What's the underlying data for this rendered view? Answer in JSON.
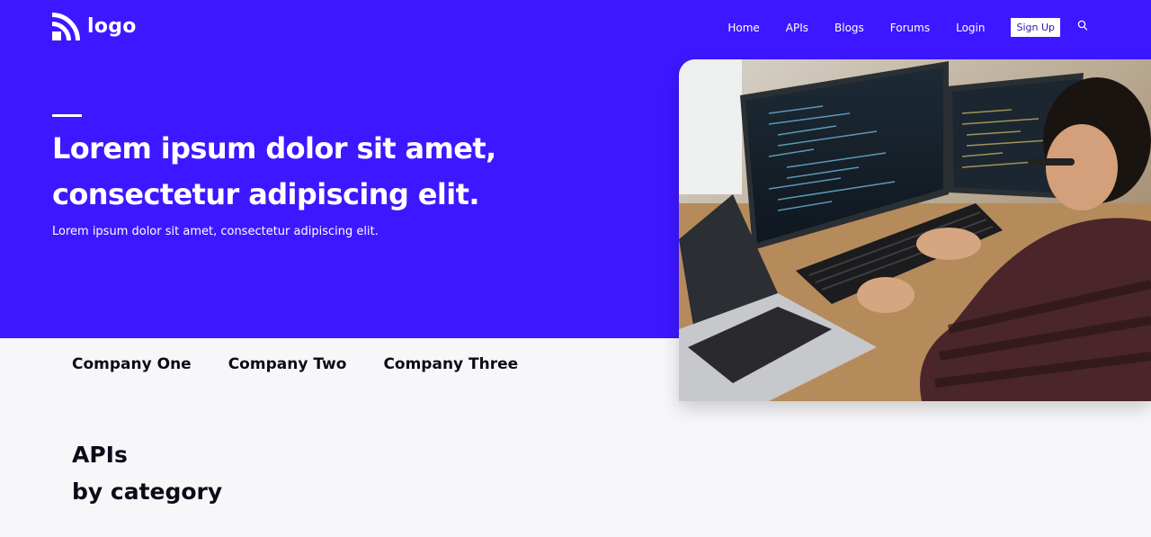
{
  "header": {
    "logo_text": "logo",
    "nav_items": [
      "Home",
      "APIs",
      "Blogs",
      "Forums",
      "Login"
    ],
    "signup_label": "Sign Up"
  },
  "hero": {
    "headline_line1": "Lorem ipsum dolor sit amet,",
    "headline_line2": "consectetur adipiscing elit.",
    "subtext": "Lorem ipsum dolor sit amet, consectetur adipiscing elit."
  },
  "companies": [
    "Company One",
    "Company Two",
    "Company Three"
  ],
  "section": {
    "title_line1": "APIs",
    "title_line2": "by category"
  },
  "colors": {
    "hero_background": "#3d17ff",
    "page_background": "#f7f7f9",
    "text_dark": "#0b0b1a"
  },
  "icons": [
    "logo-icon",
    "search-icon"
  ]
}
